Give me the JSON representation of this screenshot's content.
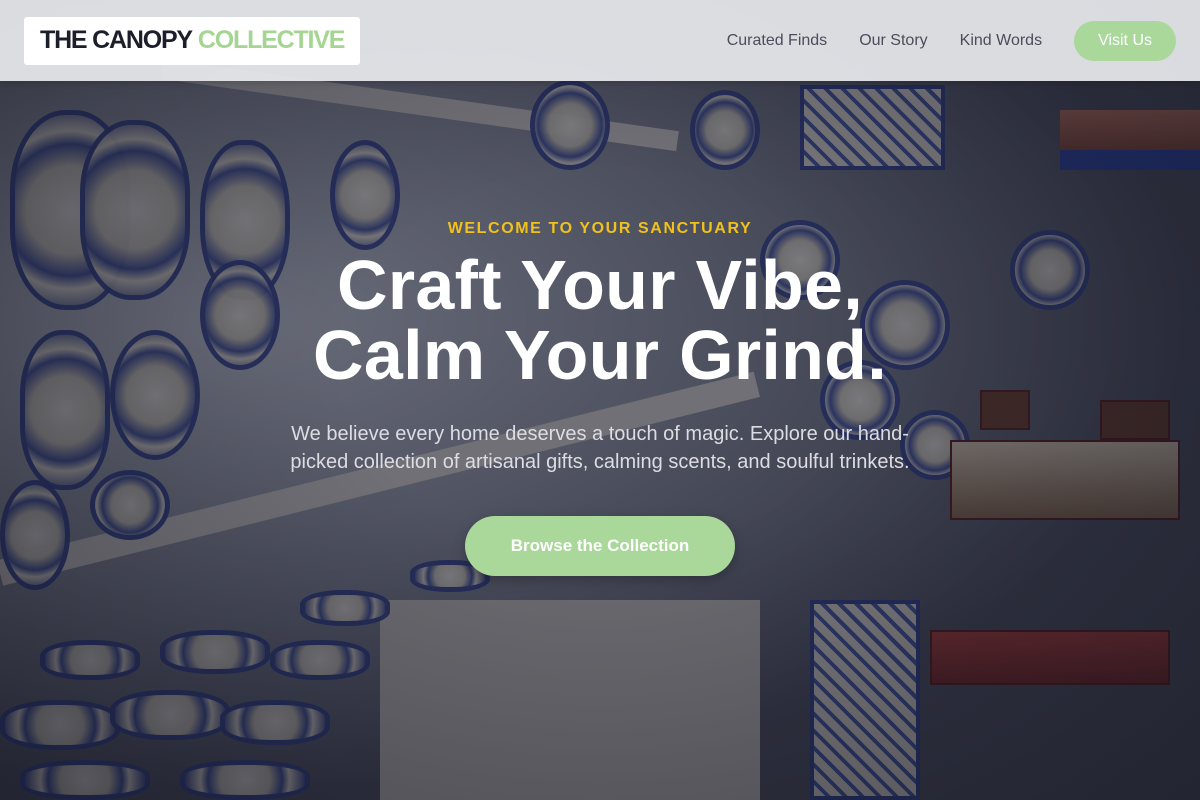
{
  "header": {
    "logo_part1": "THE CANOPY",
    "logo_part2": "COLLECTIVE",
    "nav": [
      {
        "label": "Curated Finds"
      },
      {
        "label": "Our Story"
      },
      {
        "label": "Kind Words"
      }
    ],
    "visit_label": "Visit Us"
  },
  "hero": {
    "eyebrow": "WELCOME TO YOUR SANCTUARY",
    "headline_line1": "Craft Your Vibe,",
    "headline_line2": "Calm Your Grind.",
    "subtext": "We believe every home deserves a touch of magic. Explore our hand-picked collection of artisanal gifts, calming scents, and soulful trinkets.",
    "cta_label": "Browse the Collection",
    "background_image": "ceramic-shop-photo"
  },
  "colors": {
    "accent_green": "#a9d89a",
    "eyebrow_yellow": "#f1c21b",
    "logo_dark": "#1c1e2a"
  }
}
